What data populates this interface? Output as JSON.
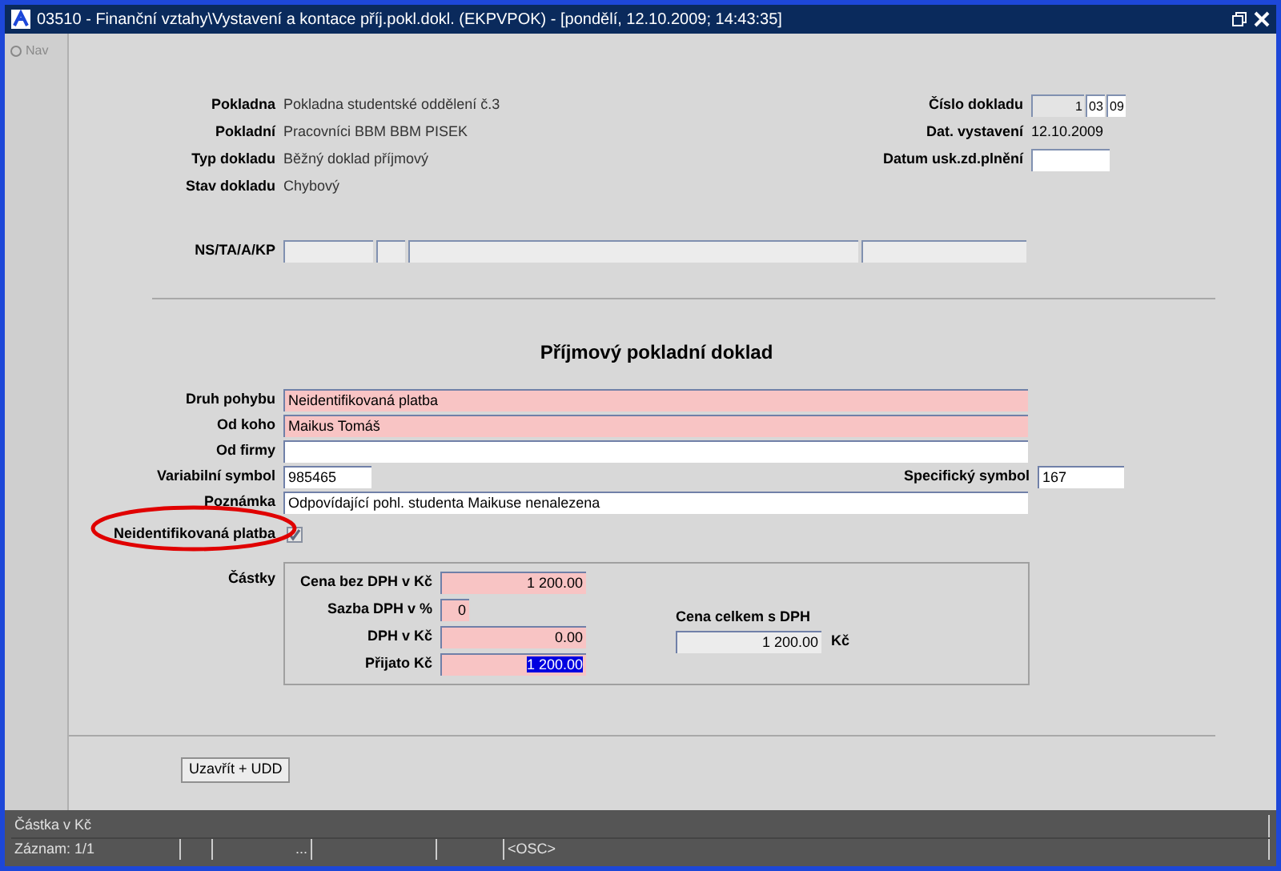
{
  "window": {
    "title": "03510 - Finanční vztahy\\Vystavení a kontace příj.pokl.dokl. (EKPVPOK) - [pondělí, 12.10.2009; 14:43:35]"
  },
  "toolbar": {
    "nav_button": "Nav"
  },
  "header_left": [
    {
      "label": "Pokladna",
      "value": "Pokladna studentské oddělení č.3"
    },
    {
      "label": "Pokladní",
      "value": "Pracovníci BBM BBM PISEK"
    },
    {
      "label": "Typ dokladu",
      "value": "Běžný doklad příjmový"
    },
    {
      "label": "Stav dokladu",
      "value": "Chybový"
    }
  ],
  "header_right": [
    {
      "label": "Číslo dokladu",
      "kind": "parts",
      "parts": [
        "1",
        "03",
        "09"
      ]
    },
    {
      "label": "Dat. vystavení",
      "kind": "text",
      "value": "12.10.2009"
    },
    {
      "label": "Datum usk.zd.plnění",
      "kind": "field"
    }
  ],
  "ns_row": {
    "label": "NS/TA/A/KP"
  },
  "heading": "Příjmový pokladní doklad",
  "form_rows": [
    {
      "kind": "wide",
      "label": "Druh pohybu",
      "value": "Neidentifikovaná platba",
      "required": true
    },
    {
      "kind": "wide",
      "label": "Od koho",
      "value": "Maikus Tomáš",
      "required": true
    },
    {
      "kind": "wide",
      "label": "Od firmy",
      "required": false
    },
    {
      "kind": "pair",
      "label": "Variabilní symbol",
      "value": "985465",
      "label_2": "Specifický symbol",
      "value_2": "167"
    },
    {
      "kind": "wide",
      "label": "Poznámka",
      "value": "Odpovídající pohl. studenta Maikuse nenalezena",
      "required": false
    },
    {
      "kind": "checkbox",
      "label": "Neidentifikovaná platba",
      "checked": true,
      "disabled": true
    }
  ],
  "annotation": {
    "kind": "ellipse"
  },
  "amounts": {
    "label": "Částky",
    "fields": [
      {
        "label": "Cena bez DPH v Kč",
        "value": "1 200.00",
        "selected": false
      },
      {
        "label": "Sazba DPH v %",
        "value": "0",
        "selected": false
      },
      {
        "label": "DPH v Kč",
        "value": "0.00",
        "selected": false
      },
      {
        "label": "Přijato Kč",
        "value": "1 200.00",
        "selected": true
      }
    ],
    "total": {
      "label": "Cena celkem s DPH",
      "value": "1 200.00",
      "unit": "Kč"
    }
  },
  "button": "Uzavřít + UDD",
  "status_bar": {
    "message": "Částka v Kč",
    "cells": [
      "Záznam: 1/1",
      "",
      "...",
      "",
      "",
      "<OSC>"
    ]
  }
}
